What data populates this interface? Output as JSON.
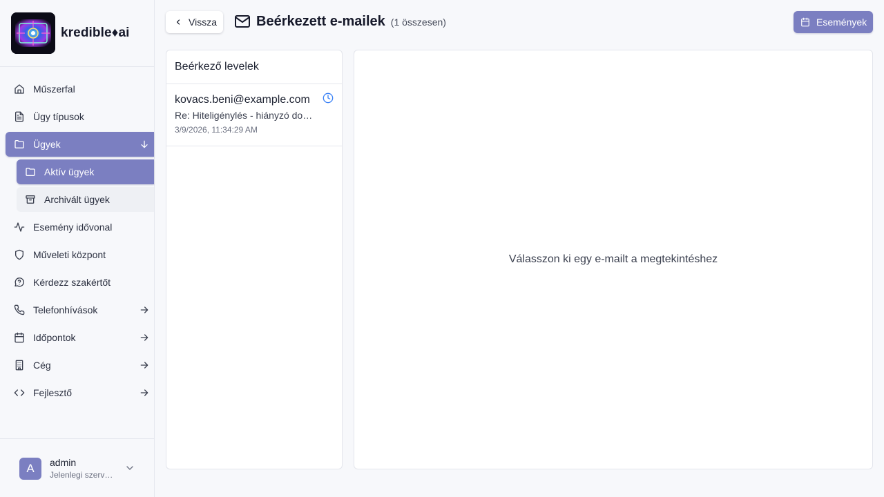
{
  "brand": {
    "name": "kredible♦ai"
  },
  "sidebar": {
    "items": [
      {
        "label": "Műszerfal",
        "icon": "home-icon"
      },
      {
        "label": "Ügy típusok",
        "icon": "file-text-icon"
      },
      {
        "label": "Ügyek",
        "icon": "folder-icon",
        "state": "active-expanded"
      },
      {
        "label": "Aktív ügyek",
        "icon": "folder-icon",
        "state": "active-sub"
      },
      {
        "label": "Archivált ügyek",
        "icon": "archive-icon"
      },
      {
        "label": "Esemény idővonal",
        "icon": "activity-icon"
      },
      {
        "label": "Műveleti központ",
        "icon": "shield-icon"
      },
      {
        "label": "Kérdezz szakértőt",
        "icon": "help-circle-icon"
      },
      {
        "label": "Telefonhívások",
        "icon": "phone-icon"
      },
      {
        "label": "Időpontok",
        "icon": "calendar-icon"
      },
      {
        "label": "Cég",
        "icon": "building-icon"
      },
      {
        "label": "Fejlesztő",
        "icon": "code-icon"
      }
    ]
  },
  "user": {
    "initial": "A",
    "name": "admin",
    "subtitle": "Jelenlegi szervezet"
  },
  "header": {
    "back_label": "Vissza",
    "title": "Beérkezett e-mailek",
    "count": "(1 összesen)",
    "events_label": "Események"
  },
  "inbox": {
    "heading": "Beérkező levelek",
    "emails": [
      {
        "from": "kovacs.beni@example.com",
        "subject": "Re: Hiteligénylés - hiányzó dokumentumok",
        "date": "3/9/2026, 11:34:29 AM",
        "status_icon": "clock-icon"
      }
    ]
  },
  "viewer": {
    "empty_message": "Válasszon ki egy e-mailt a megtekintéshez"
  },
  "colors": {
    "accent": "#7b7fc1",
    "clock": "#3b82f6"
  }
}
